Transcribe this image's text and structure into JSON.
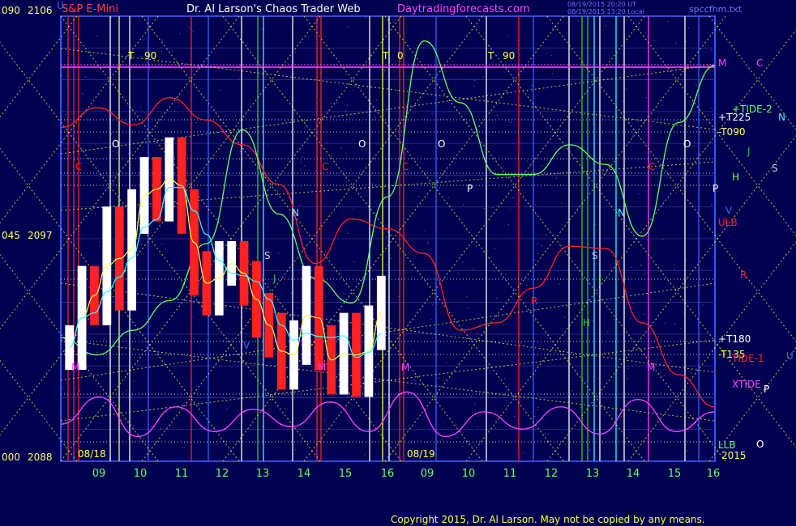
{
  "header": {
    "symbol": "S&P E-Mini",
    "title": "Dr. Al Larson's Chaos Trader Web",
    "site": "Daytradingforecasts.com",
    "stamp1": "08/19/2015 20:20 UT",
    "stamp2": "08/19/2015 13:20 Local",
    "file": "spccfhm.txt"
  },
  "y_axis": {
    "top_left": "090",
    "top_right": "2106",
    "mid_left": "045",
    "mid_right": "2097",
    "bot_left": "000",
    "bot_right": "2088"
  },
  "dates": {
    "left": "08/18",
    "right": "08/19",
    "year": "2015"
  },
  "footer": "Copyright 2015, Dr. Al Larson. May not be copied by any means.",
  "colors": {
    "background": "#000050",
    "yellow": "#ffff44",
    "red": "#ff2222",
    "green": "#33dd33",
    "cyan": "#33ffff",
    "magenta": "#ff44ff",
    "white": "#ffffff"
  },
  "chart_data": {
    "type": "line",
    "title": "S&P E-Mini",
    "ylim": [
      2088,
      2106
    ],
    "x_ticks": [
      "09",
      "10",
      "11",
      "12",
      "13",
      "14",
      "15",
      "16",
      "09",
      "10",
      "11",
      "12",
      "13",
      "14",
      "15",
      "16"
    ],
    "right_labels": [
      {
        "text": "M",
        "color": "#ff44ff"
      },
      {
        "text": "C",
        "color": "#ff44ff"
      },
      {
        "text": "+TIDE-2",
        "color": "#66ff66"
      },
      {
        "text": "N",
        "color": "#33ffff"
      },
      {
        "text": "+T225",
        "color": "#ffffff"
      },
      {
        "text": "-T090",
        "color": "#ffff44"
      },
      {
        "text": "J",
        "color": "#33cc33"
      },
      {
        "text": "S",
        "color": "#cccccc"
      },
      {
        "text": "H",
        "color": "#66ff66"
      },
      {
        "text": "V",
        "color": "#3366ff"
      },
      {
        "text": "ULB",
        "color": "#ff2222"
      },
      {
        "text": "R",
        "color": "#ff2222"
      },
      {
        "text": "+T180",
        "color": "#ffffff"
      },
      {
        "text": "-T135",
        "color": "#ffff44"
      },
      {
        "text": "TIDE-1",
        "color": "#ff2222"
      },
      {
        "text": "U",
        "color": "#3366ff"
      },
      {
        "text": "XTIDE",
        "color": "#ff44ff"
      },
      {
        "text": "P",
        "color": "#ffffff"
      },
      {
        "text": "LLB",
        "color": "#66ff66"
      },
      {
        "text": "O",
        "color": "#ffffff"
      }
    ],
    "chart_letters": [
      {
        "text": "T",
        "color": "#ffff44"
      },
      {
        "text": "90",
        "color": "#ffff44"
      },
      {
        "text": "T",
        "color": "#ffff44"
      },
      {
        "text": "0",
        "color": "#ffff44"
      },
      {
        "text": "T",
        "color": "#ffff44"
      },
      {
        "text": "90",
        "color": "#ffff44"
      },
      {
        "text": "O",
        "color": "#ffffff"
      },
      {
        "text": "O",
        "color": "#ffffff"
      },
      {
        "text": "O",
        "color": "#ffffff"
      },
      {
        "text": "O",
        "color": "#ffffff"
      },
      {
        "text": "C",
        "color": "#ff2222"
      },
      {
        "text": "C",
        "color": "#ff2222"
      },
      {
        "text": "C",
        "color": "#ff2222"
      },
      {
        "text": "C",
        "color": "#ff2222"
      },
      {
        "text": "P",
        "color": "#ffffff"
      },
      {
        "text": "P",
        "color": "#ffffff"
      },
      {
        "text": "N",
        "color": "#33ffff"
      },
      {
        "text": "N",
        "color": "#33ffff"
      },
      {
        "text": "S",
        "color": "#cccccc"
      },
      {
        "text": "S",
        "color": "#cccccc"
      },
      {
        "text": "J",
        "color": "#33cc33"
      },
      {
        "text": "J",
        "color": "#33cc33"
      },
      {
        "text": "R",
        "color": "#ff2222"
      },
      {
        "text": "H",
        "color": "#33cc33"
      },
      {
        "text": "M",
        "color": "#ff44ff"
      },
      {
        "text": "M",
        "color": "#ff44ff"
      },
      {
        "text": "M",
        "color": "#ff44ff"
      },
      {
        "text": "M",
        "color": "#ff44ff"
      },
      {
        "text": "V",
        "color": "#3366ff"
      },
      {
        "text": "U",
        "color": "#3366ff"
      }
    ],
    "price_bars_close": [
      2092.6,
      2095.0,
      2094.4,
      2097.4,
      2095.0,
      2098.1,
      2099.4,
      2098.6,
      2100.2,
      2098.1,
      2095.6,
      2094.8,
      2096.0,
      2096.0,
      2095.2,
      2093.9,
      2093.1,
      2091.8,
      2092.8,
      2095.0,
      2092.6,
      2091.6,
      2093.1,
      2091.5,
      2093.4,
      2094.6
    ],
    "series": [
      {
        "name": "XTIDE",
        "color": "#ff44ff",
        "values": [
          2089.5,
          2090.6,
          2089.0,
          2090.2,
          2089.2,
          2090.1,
          2089.4,
          2090.4,
          2089.2,
          2090.8,
          2089.0,
          2090.0,
          2089.3,
          2090.2,
          2089.1,
          2090.5,
          2089.2,
          2090.0
        ]
      },
      {
        "name": "TIDE-1",
        "color": "#ff2222",
        "values": [
          2101.5,
          2102.3,
          2101.6,
          2102.7,
          2101.8,
          2100.8,
          2099.2,
          2096.0,
          2097.8,
          2097.4,
          2096.4,
          2093.3,
          2093.6,
          2095.0,
          2096.7,
          2096.6,
          2093.6,
          2091.5,
          2090.2
        ]
      },
      {
        "name": "+TIDE-2",
        "color": "#66ff66",
        "values": [
          2093.0,
          2092.3,
          2093.3,
          2094.5,
          2096.8,
          2101.4,
          2098.0,
          2095.4,
          2094.4,
          2098.7,
          2105.0,
          2102.5,
          2099.6,
          2099.6,
          2100.8,
          2100.0,
          2097.1,
          2101.7,
          2104.0
        ]
      }
    ]
  }
}
